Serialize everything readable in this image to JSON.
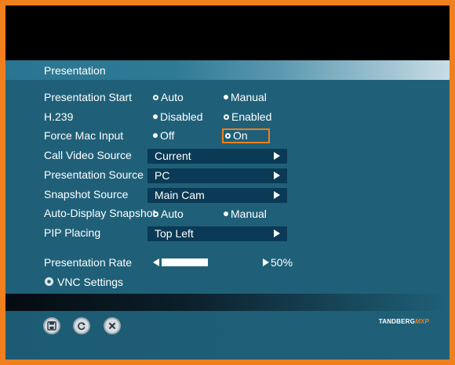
{
  "menu": {
    "title": "Presentation",
    "rows": [
      {
        "label": "Presentation Start",
        "type": "radio",
        "options": [
          "Auto",
          "Manual"
        ],
        "selected": 1
      },
      {
        "label": "H.239",
        "type": "radio",
        "options": [
          "Disabled",
          "Enabled"
        ],
        "selected": 0
      },
      {
        "label": "Force Mac Input",
        "type": "radio",
        "options": [
          "Off",
          "On"
        ],
        "selected": 0,
        "focused_option": 1
      },
      {
        "label": "Call Video Source",
        "type": "select",
        "value": "Current"
      },
      {
        "label": "Presentation Source",
        "type": "select",
        "value": "PC"
      },
      {
        "label": "Snapshot Source",
        "type": "select",
        "value": "Main Cam"
      },
      {
        "label": "Auto-Display Snapshot",
        "type": "radio",
        "options": [
          "Auto",
          "Manual"
        ],
        "selected": 1
      },
      {
        "label": "PIP Placing",
        "type": "select",
        "value": "Top Left"
      },
      {
        "label": "Presentation Rate",
        "type": "slider",
        "value_text": "50%",
        "value": 50
      }
    ],
    "submenu": {
      "label": "VNC Settings"
    }
  },
  "footer": {
    "buttons": [
      {
        "name": "save-icon"
      },
      {
        "name": "refresh-icon"
      },
      {
        "name": "close-icon"
      }
    ],
    "brand": {
      "text": "TANDBERG",
      "suffix": "MXP"
    }
  },
  "colors": {
    "accent": "#f07f1d",
    "panel": "#1f6078",
    "select_bg": "#0a3a55"
  }
}
